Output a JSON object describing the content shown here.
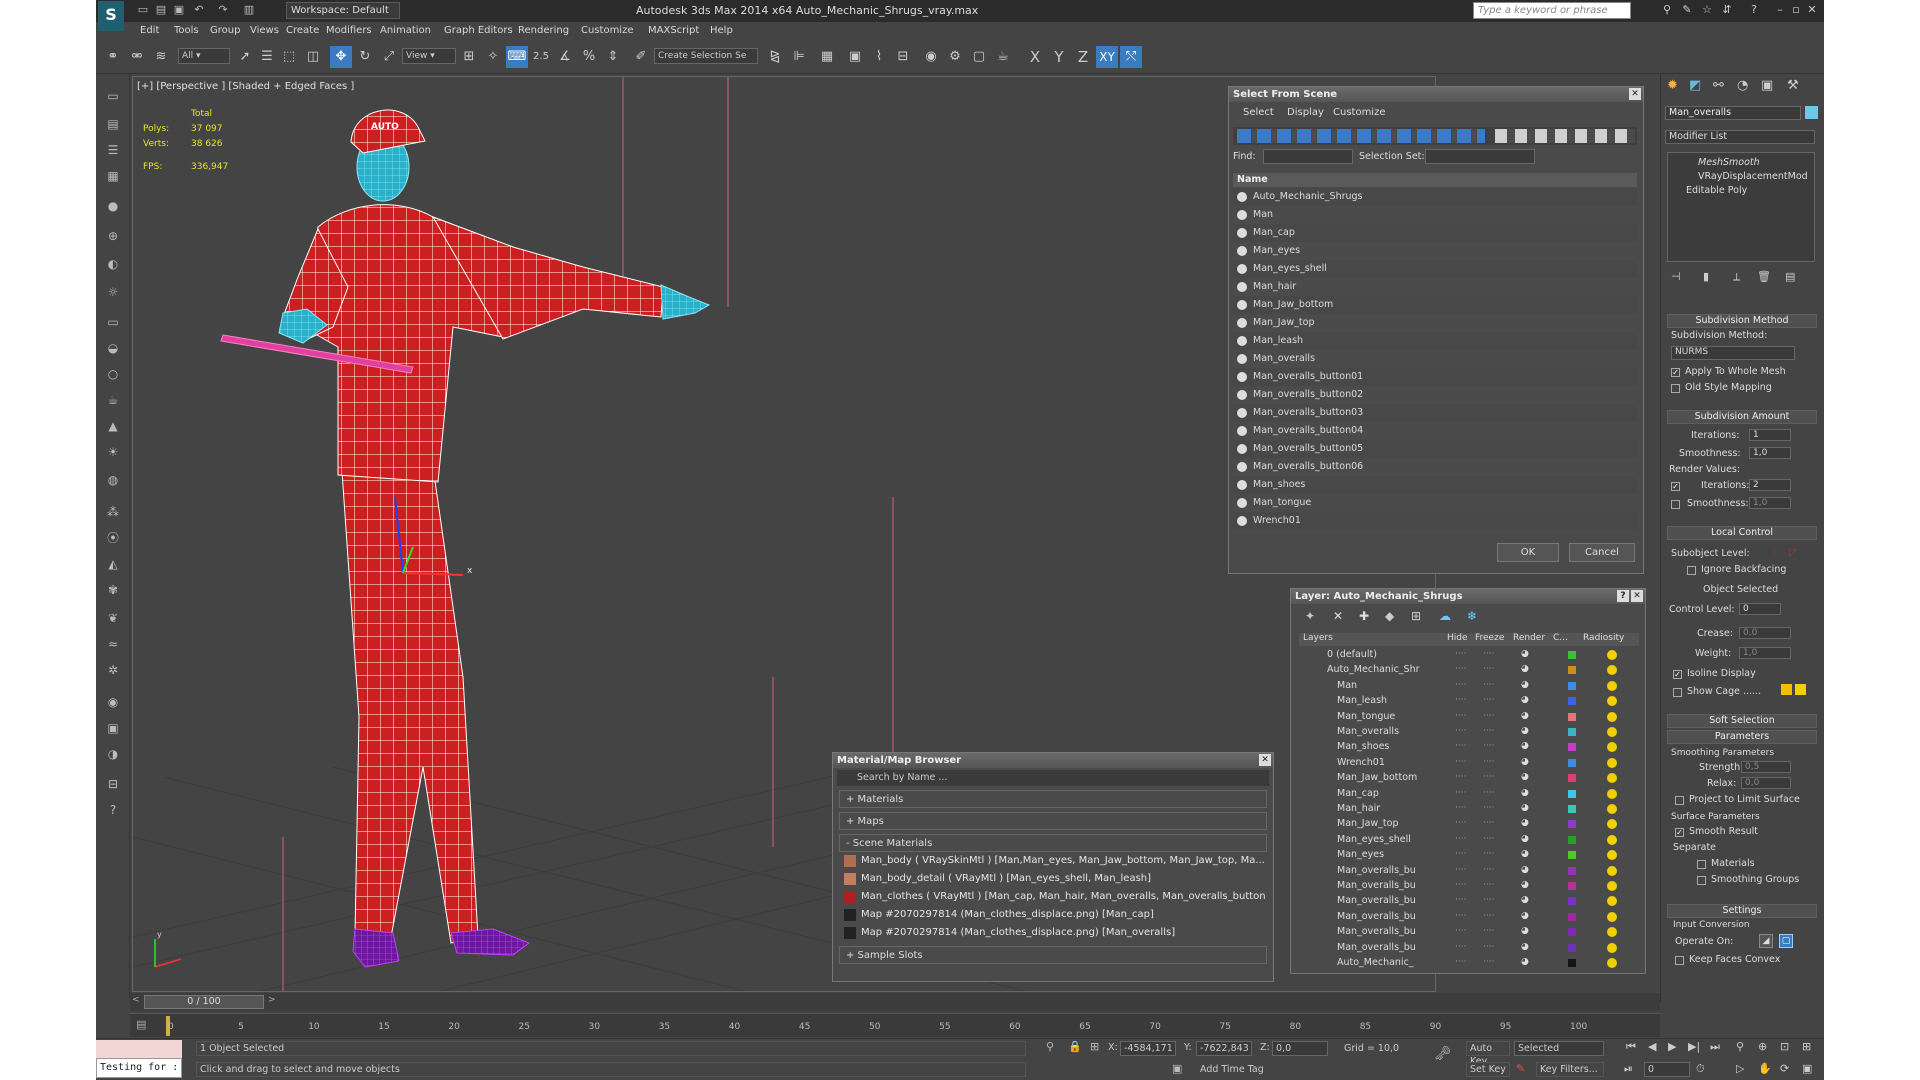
{
  "titlebar": {
    "logo": "S",
    "workspace": "Workspace: Default",
    "title": "Autodesk 3ds Max  2014 x64     Auto_Mechanic_Shrugs_vray.max",
    "search_placeholder": "Type a keyword or phrase"
  },
  "menu": [
    "Edit",
    "Tools",
    "Group",
    "Views",
    "Create",
    "Modifiers",
    "Animation",
    "Graph Editors",
    "Rendering",
    "Customize",
    "MAXScript",
    "Help"
  ],
  "toolbar": {
    "filter": "All",
    "refcoord": "View",
    "selset": "Create Selection Se",
    "axes": [
      "X",
      "Y",
      "Z",
      "XY"
    ],
    "snap": "2.5"
  },
  "viewport": {
    "label": "[+] [Perspective ] [Shaded + Edged Faces ]",
    "stats": {
      "header": "Total",
      "polys_label": "Polys:",
      "polys": "37 097",
      "verts_label": "Verts:",
      "verts": "38 626",
      "fps_label": "FPS:",
      "fps": "336,947"
    },
    "axis_x": "x",
    "axis_y": "y"
  },
  "select_from_scene": {
    "title": "Select From Scene",
    "tabs": [
      "Select",
      "Display",
      "Customize"
    ],
    "find_label": "Find:",
    "selset_label": "Selection Set:",
    "column": "Name",
    "items": [
      "Auto_Mechanic_Shrugs",
      "Man",
      "Man_cap",
      "Man_eyes",
      "Man_eyes_shell",
      "Man_hair",
      "Man_Jaw_bottom",
      "Man_Jaw_top",
      "Man_leash",
      "Man_overalls",
      "Man_overalls_button01",
      "Man_overalls_button02",
      "Man_overalls_button03",
      "Man_overalls_button04",
      "Man_overalls_button05",
      "Man_overalls_button06",
      "Man_shoes",
      "Man_tongue",
      "Wrench01"
    ],
    "ok": "OK",
    "cancel": "Cancel"
  },
  "material_browser": {
    "title": "Material/Map Browser",
    "search": "Search by Name ...",
    "sections": {
      "materials": "+ Materials",
      "maps": "+ Maps",
      "scene": "- Scene Materials",
      "samples": "+ Sample Slots"
    },
    "scene_materials": [
      {
        "text": "Man_body  ( VRaySkinMtl ) [Man,Man_eyes, Man_Jaw_bottom, Man_Jaw_top, Ma...",
        "color": "#b07050"
      },
      {
        "text": "Man_body_detail  ( VRayMtl ) [Man_eyes_shell, Man_leash]",
        "color": "#c08060"
      },
      {
        "text": "Man_clothes  ( VRayMtl ) [Man_cap, Man_hair, Man_overalls, Man_overalls_button...",
        "color": "#b02020"
      },
      {
        "text": "Map #2070297814 (Man_clothes_displace.png) [Man_cap]",
        "color": "#222222"
      },
      {
        "text": "Map #2070297814 (Man_clothes_displace.png) [Man_overalls]",
        "color": "#222222"
      }
    ]
  },
  "layer_manager": {
    "title": "Layer: Auto_Mechanic_Shrugs",
    "columns": [
      "Layers",
      "Hide",
      "Freeze",
      "Render",
      "C...",
      "Radiosity"
    ],
    "rows": [
      {
        "name": "0 (default)",
        "indent": 0,
        "color": "#3cc03c"
      },
      {
        "name": "Auto_Mechanic_Shr",
        "indent": 0,
        "color": "#d08c1e"
      },
      {
        "name": "Man",
        "indent": 1,
        "color": "#3c8ce0"
      },
      {
        "name": "Man_leash",
        "indent": 1,
        "color": "#3c64e0"
      },
      {
        "name": "Man_tongue",
        "indent": 1,
        "color": "#e07878"
      },
      {
        "name": "Man_overalls",
        "indent": 1,
        "color": "#3cb4c8"
      },
      {
        "name": "Man_shoes",
        "indent": 1,
        "color": "#c83cc8"
      },
      {
        "name": "Wrench01",
        "indent": 1,
        "color": "#3c8ce0"
      },
      {
        "name": "Man_Jaw_bottom",
        "indent": 1,
        "color": "#e03c78"
      },
      {
        "name": "Man_cap",
        "indent": 1,
        "color": "#3cc8e0"
      },
      {
        "name": "Man_hair",
        "indent": 1,
        "color": "#3cc8b4"
      },
      {
        "name": "Man_Jaw_top",
        "indent": 1,
        "color": "#8c3cc8"
      },
      {
        "name": "Man_eyes_shell",
        "indent": 1,
        "color": "#28a028"
      },
      {
        "name": "Man_eyes",
        "indent": 1,
        "color": "#50c828"
      },
      {
        "name": "Man_overalls_bu",
        "indent": 1,
        "color": "#9632b4"
      },
      {
        "name": "Man_overalls_bu",
        "indent": 1,
        "color": "#b43296"
      },
      {
        "name": "Man_overalls_bu",
        "indent": 1,
        "color": "#7832c8"
      },
      {
        "name": "Man_overalls_bu",
        "indent": 1,
        "color": "#a028a0"
      },
      {
        "name": "Man_overalls_bu",
        "indent": 1,
        "color": "#8228b4"
      },
      {
        "name": "Man_overalls_bu",
        "indent": 1,
        "color": "#6e32b4"
      },
      {
        "name": "Auto_Mechanic_",
        "indent": 1,
        "color": "#141414"
      }
    ]
  },
  "command_panel": {
    "object_name": "Man_overalls",
    "modifier_list": "Modifier List",
    "stack": [
      "MeshSmooth",
      "VRayDisplacementMod",
      "Editable Poly"
    ],
    "subdiv_method_hdr": "Subdivision Method",
    "subdiv_method_label": "Subdivision Method:",
    "subdiv_method": "NURMS",
    "apply_whole": "Apply To Whole Mesh",
    "old_style": "Old Style Mapping",
    "subdiv_amount_hdr": "Subdivision Amount",
    "iterations_label": "Iterations:",
    "iterations": "1",
    "smoothness_label": "Smoothness:",
    "smoothness": "1,0",
    "render_values": "Render Values:",
    "r_iterations": "2",
    "r_smoothness": "1,0",
    "local_control_hdr": "Local Control",
    "subobject_level": "Subobject Level:",
    "ignore_backfacing": "Ignore Backfacing",
    "object_selected": "Object Selected",
    "control_level": "Control Level:",
    "control_level_val": "0",
    "crease": "Crease:",
    "crease_val": "0,0",
    "weight": "Weight:",
    "weight_val": "1,0",
    "isoline": "Isoline Display",
    "show_cage": "Show Cage ......",
    "soft_selection_hdr": "Soft Selection",
    "parameters_hdr": "Parameters",
    "smoothing_params": "Smoothing Parameters",
    "strength": "Strength:",
    "strength_val": "0,5",
    "relax": "Relax:",
    "relax_val": "0,0",
    "project_limit": "Project to Limit Surface",
    "surface_params": "Surface Parameters",
    "smooth_result": "Smooth Result",
    "separate": "Separate",
    "materials": "Materials",
    "smoothing_groups": "Smoothing Groups",
    "settings_hdr": "Settings",
    "input_conversion": "Input Conversion",
    "operate_on": "Operate On:",
    "keep_faces_convex": "Keep Faces Convex"
  },
  "timeline": {
    "frame": "0 / 100",
    "ticks": [
      "0",
      "5",
      "10",
      "15",
      "20",
      "25",
      "30",
      "35",
      "40",
      "45",
      "50",
      "55",
      "60",
      "65",
      "70",
      "75",
      "80",
      "85",
      "90",
      "95",
      "100"
    ]
  },
  "status": {
    "maxscript": "Testing for :",
    "selected": "1 Object Selected",
    "prompt": "Click and drag to select and move objects",
    "x_label": "X:",
    "x": "-4584,171",
    "y_label": "Y:",
    "y": "-7622,843",
    "z_label": "Z:",
    "z": "0,0",
    "grid": "Grid = 10,0",
    "auto_key": "Auto Key",
    "set_key": "Set Key",
    "key_mode": "Selected",
    "key_filters": "Key Filters...",
    "add_time_tag": "Add Time Tag",
    "frame_field": "0"
  }
}
